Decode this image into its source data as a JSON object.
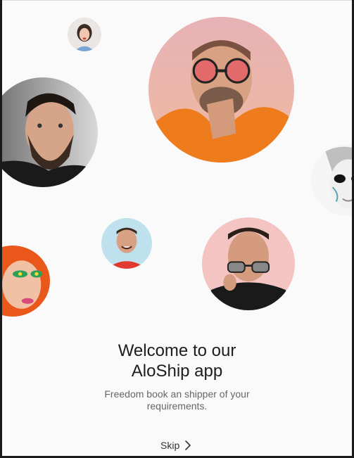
{
  "onboarding": {
    "title_line1": "Welcome to our",
    "title_line2": "AloShip app",
    "subtitle_line1": "Freedom book an shipper of your",
    "subtitle_line2": "requirements.",
    "skip_label": "Skip",
    "skip_icon": "chevron-right-icon"
  },
  "avatars": [
    {
      "name": "avatar-woman-smiling"
    },
    {
      "name": "avatar-man-sunglasses-orange-hoodie"
    },
    {
      "name": "avatar-bearded-man"
    },
    {
      "name": "avatar-face-paint-white"
    },
    {
      "name": "avatar-man-laughing-red-shirt"
    },
    {
      "name": "avatar-man-glasses-pink"
    },
    {
      "name": "avatar-woman-colorful-makeup"
    }
  ],
  "colors": {
    "background": "#fafafa",
    "title": "#1d1d1d",
    "subtitle": "#666666"
  }
}
